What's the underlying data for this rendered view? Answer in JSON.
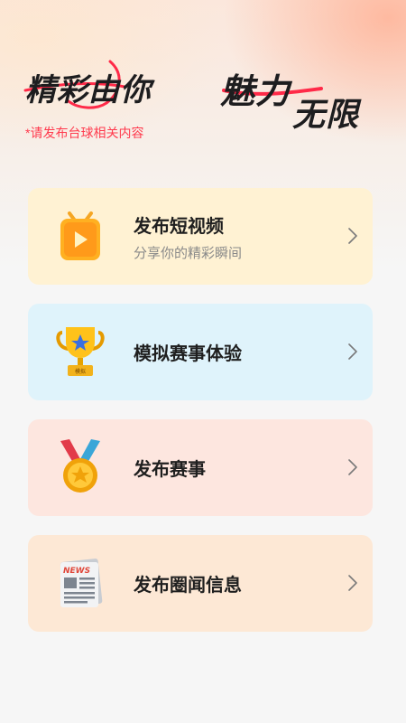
{
  "header": {
    "slogan_left": "精彩由你",
    "slogan_right_a": "魅力",
    "slogan_right_b": "无限",
    "hint": "*请发布台球相关内容",
    "accent_color": "#ff3b4e"
  },
  "cards": [
    {
      "title": "发布短视频",
      "subtitle": "分享你的精彩瞬间",
      "icon": "video-play-icon",
      "bg": "#fff2d3"
    },
    {
      "title": "模拟赛事体验",
      "subtitle": "",
      "icon": "trophy-icon",
      "bg": "#dff3fb",
      "icon_label": "模拟"
    },
    {
      "title": "发布赛事",
      "subtitle": "",
      "icon": "medal-icon",
      "bg": "#fde6df"
    },
    {
      "title": "发布圈闻信息",
      "subtitle": "",
      "icon": "news-icon",
      "bg": "#fde8d5",
      "icon_label": "NEWS"
    }
  ]
}
